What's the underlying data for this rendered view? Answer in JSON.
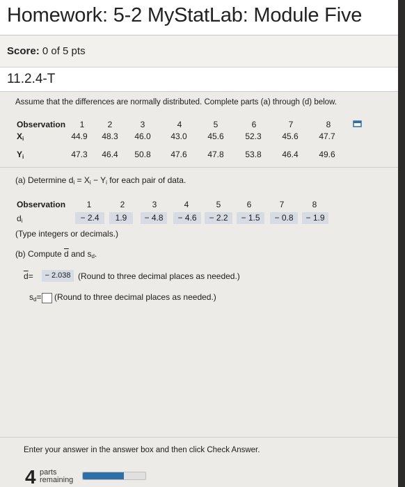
{
  "header": {
    "title": "Homework: 5-2 MyStatLab: Module Five"
  },
  "score": {
    "label": "Score:",
    "value": "0 of 5 pts"
  },
  "question": {
    "id": "11.2.4-T"
  },
  "instructions": "Assume that the differences are normally distributed. Complete parts (a) through (d) below.",
  "table": {
    "headers": [
      "Observation",
      "1",
      "2",
      "3",
      "4",
      "5",
      "6",
      "7",
      "8"
    ],
    "x_label": "X",
    "x_sub": "i",
    "y_label": "Y",
    "y_sub": "i",
    "x_values": [
      "44.9",
      "48.3",
      "46.0",
      "43.0",
      "45.6",
      "52.3",
      "45.6",
      "47.7"
    ],
    "y_values": [
      "47.3",
      "46.4",
      "50.8",
      "47.6",
      "47.8",
      "53.8",
      "46.4",
      "49.6"
    ]
  },
  "part_a": {
    "prompt_prefix": "(a) Determine d",
    "prompt_mid": " = X",
    "prompt_mid2": " − Y",
    "prompt_suffix": " for each pair of data.",
    "sub": "i",
    "obs_label": "Observation",
    "obs_numbers": [
      "1",
      "2",
      "3",
      "4",
      "5",
      "6",
      "7",
      "8"
    ],
    "d_label": "d",
    "d_sub": "i",
    "d_values": [
      "− 2.4",
      "1.9",
      "− 4.8",
      "− 4.6",
      "− 2.2",
      "− 1.5",
      "− 0.8",
      "− 1.9"
    ],
    "type_note": "(Type integers or decimals.)"
  },
  "part_b": {
    "prompt_prefix": "(b) Compute",
    "dbar": "d",
    "and": "and",
    "s": "s",
    "s_sub": "d",
    "dbar_eq": "=",
    "dbar_value": "− 2.038",
    "dbar_note": "(Round to three decimal places as needed.)",
    "sd_eq": "=",
    "sd_note": "(Round to three decimal places as needed.)"
  },
  "footer": {
    "instruction": "Enter your answer in the answer box and then click Check Answer.",
    "count": "4",
    "parts_label": "parts",
    "remaining_label": "remaining",
    "progress_fraction": 0.65
  }
}
